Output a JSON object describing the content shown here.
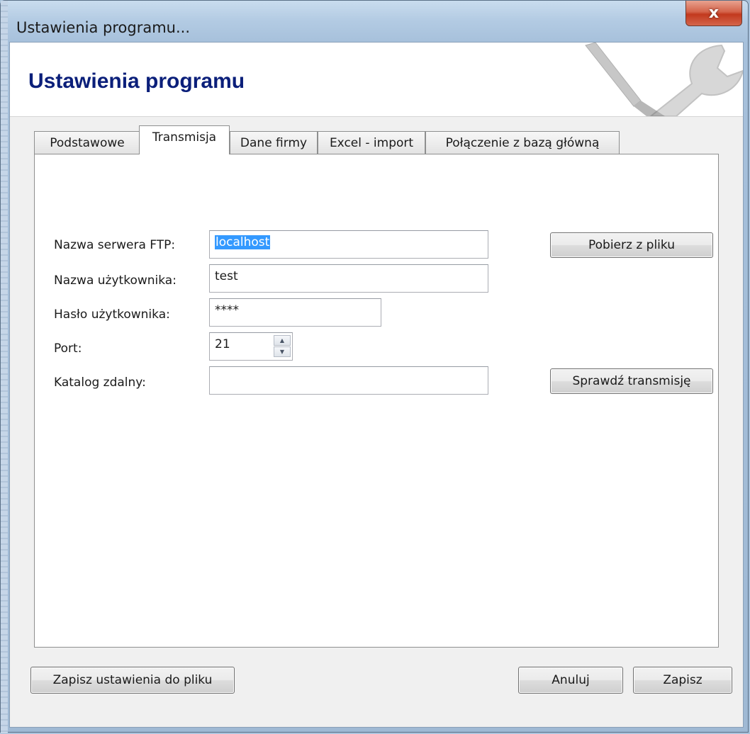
{
  "window": {
    "title": "Ustawienia programu...",
    "close_label": "x"
  },
  "header": {
    "title": "Ustawienia programu"
  },
  "tabs": [
    {
      "label": "Podstawowe",
      "active": false
    },
    {
      "label": "Transmisja",
      "active": true
    },
    {
      "label": "Dane firmy",
      "active": false
    },
    {
      "label": "Excel - import",
      "active": false
    },
    {
      "label": "Połączenie z bazą główną",
      "active": false
    }
  ],
  "form": {
    "ftp_server_label": "Nazwa serwera FTP:",
    "ftp_server_value": "localhost",
    "username_label": "Nazwa użytkownika:",
    "username_value": "test",
    "password_label": "Hasło użytkownika:",
    "password_value": "****",
    "port_label": "Port:",
    "port_value": "21",
    "remote_dir_label": "Katalog zdalny:",
    "remote_dir_value": ""
  },
  "buttons": {
    "load_from_file": "Pobierz z pliku",
    "test_transmission": "Sprawdź transmisję",
    "save_to_file": "Zapisz ustawienia do pliku",
    "cancel": "Anuluj",
    "save": "Zapisz"
  },
  "icons": {
    "header_art": "wrench-screwdriver-icon",
    "close": "close-icon",
    "spin_up": "arrow-up-icon",
    "spin_down": "arrow-down-icon"
  },
  "colors": {
    "header_title": "#0b1f7a",
    "selection": "#3399ff",
    "close_button": "#c2391e"
  }
}
